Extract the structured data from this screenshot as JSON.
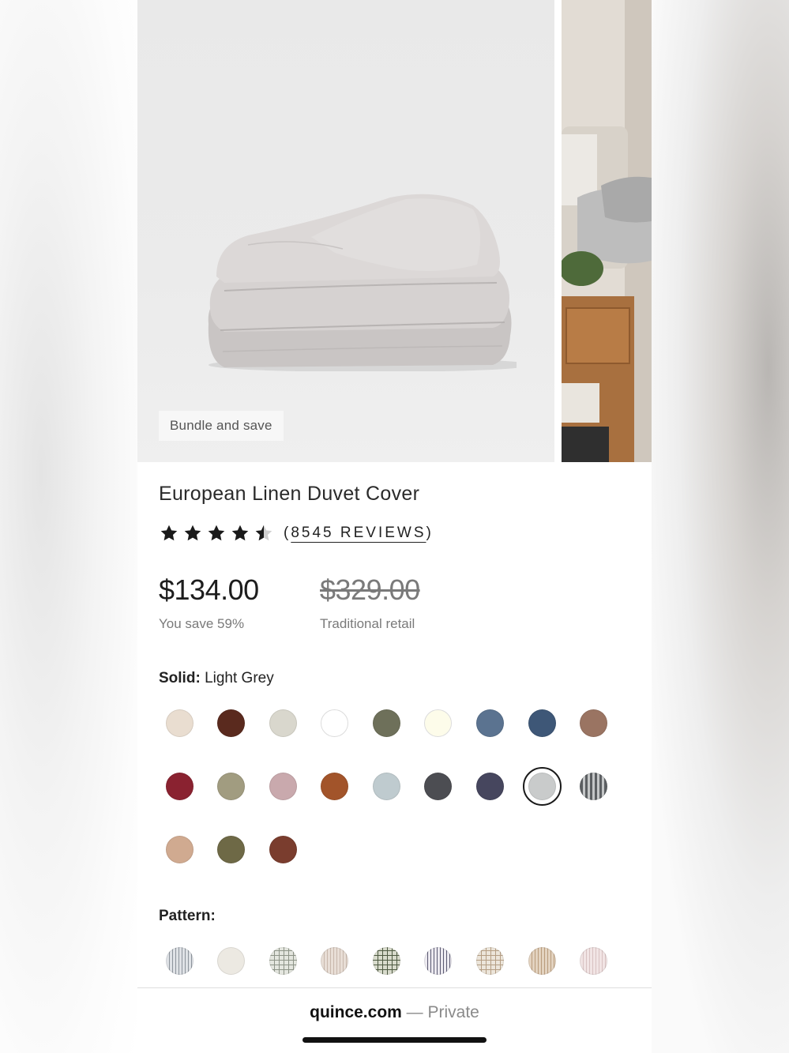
{
  "badge": "Bundle and save",
  "product": {
    "title": "European Linen Duvet Cover",
    "rating": 4.5,
    "rating_max": 5,
    "reviews_open": "(",
    "reviews_text": "8545 REVIEWS",
    "reviews_close": ")"
  },
  "price": {
    "current": "$134.00",
    "savings": "You save 59%",
    "original": "$329.00",
    "original_label": "Traditional retail"
  },
  "solid": {
    "label": "Solid:",
    "selected": "Light Grey",
    "colors": [
      "#e9ddd0",
      "#5a2a1e",
      "#d9d7cd",
      "#ffffff",
      "#6e705a",
      "#fdfcea",
      "#5b7390",
      "#3e5777",
      "#9a7462",
      "#8a2230",
      "#a19c80",
      "#c9a9ad",
      "#a2542a",
      "#bfcbcf",
      "#4c4d52",
      "#46465e",
      "#c9cbcb",
      "#5c5f62",
      "#d0aa90",
      "#6e6946",
      "#7a3d2e"
    ],
    "selected_index": 16,
    "striped_index": 17
  },
  "pattern": {
    "label": "Pattern:",
    "swatches": [
      {
        "base": "#dfe2e6",
        "line": "#8d949c",
        "kind": "stripe"
      },
      {
        "base": "#ece9e2",
        "line": "#d6d1c6",
        "kind": "plain"
      },
      {
        "base": "#e4e6df",
        "line": "#8e9488",
        "kind": "grid"
      },
      {
        "base": "#e8ded6",
        "line": "#c8b8ac",
        "kind": "stripe"
      },
      {
        "base": "#d8dbcc",
        "line": "#4e5a42",
        "kind": "grid"
      },
      {
        "base": "#eceaf0",
        "line": "#5b5a72",
        "kind": "stripe"
      },
      {
        "base": "#ece5da",
        "line": "#b59e84",
        "kind": "grid"
      },
      {
        "base": "#e3d3c0",
        "line": "#b99c7c",
        "kind": "stripe"
      },
      {
        "base": "#f1e4e4",
        "line": "#d8c2c2",
        "kind": "stripe"
      }
    ]
  },
  "browser": {
    "domain": "quince.com",
    "separator": " — ",
    "mode": "Private"
  }
}
